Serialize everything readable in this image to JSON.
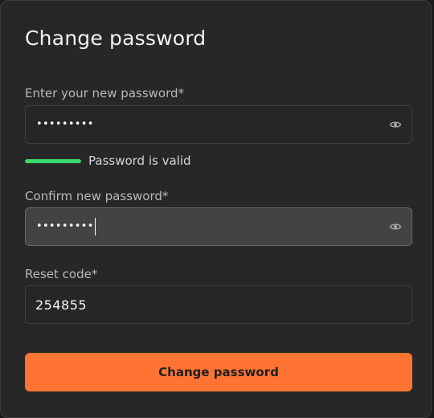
{
  "form": {
    "title": "Change password",
    "new_password": {
      "label": "Enter your new password*",
      "masked_value": "•••••••••",
      "toggle_icon": "eye-icon"
    },
    "strength": {
      "level": 1.0,
      "status_text": "Password is valid",
      "color": "#3bd96a"
    },
    "confirm_password": {
      "label": "Confirm new password*",
      "masked_value": "•••••••••",
      "toggle_icon": "eye-icon"
    },
    "reset_code": {
      "label": "Reset code*",
      "value": "254855"
    },
    "submit_label": "Change password"
  },
  "colors": {
    "accent": "#ff7433",
    "card_background": "#272727",
    "focused_field_background": "#434343",
    "valid": "#3bd96a"
  }
}
